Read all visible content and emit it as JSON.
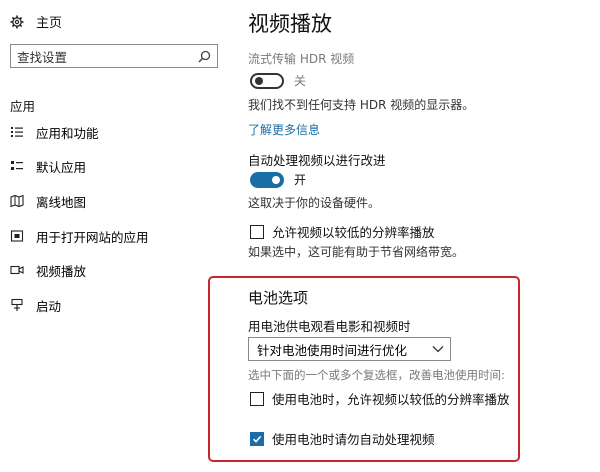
{
  "sidebar": {
    "home": {
      "label": "主页",
      "icon": "gear-icon"
    },
    "search": {
      "placeholder": "查找设置",
      "value": "查找设置",
      "icon": "search-icon"
    },
    "section_label": "应用",
    "items": [
      {
        "label": "应用和功能",
        "icon": "apps-list-icon",
        "selected": false
      },
      {
        "label": "默认应用",
        "icon": "default-apps-icon",
        "selected": false
      },
      {
        "label": "离线地图",
        "icon": "offline-maps-icon",
        "selected": false
      },
      {
        "label": "用于打开网站的应用",
        "icon": "apps-for-websites-icon",
        "selected": false
      },
      {
        "label": "视频播放",
        "icon": "video-playback-icon",
        "selected": true
      },
      {
        "label": "启动",
        "icon": "startup-icon",
        "selected": false
      }
    ]
  },
  "main": {
    "title": "视频播放",
    "hdr": {
      "heading": "流式传输 HDR 视频",
      "toggle_state": "关",
      "toggle_on": false,
      "note": "我们找不到任何支持 HDR 视频的显示器。",
      "link": "了解更多信息"
    },
    "auto_process": {
      "heading": "自动处理视频以进行改进",
      "toggle_state": "开",
      "toggle_on": true,
      "note": "这取决于你的设备硬件。"
    },
    "low_res": {
      "label": "允许视频以较低的分辨率播放",
      "checked": false,
      "note": "如果选中，这可能有助于节省网络带宽。"
    },
    "battery": {
      "heading": "电池选项",
      "subheading": "用电池供电观看电影和视频时",
      "select_value": "针对电池使用时间进行优化",
      "hint": "选中下面的一个或多个复选框，改善电池使用时间:",
      "options": [
        {
          "label": "使用电池时，允许视频以较低的分辨率播放",
          "checked": false
        },
        {
          "label": "使用电池时请勿自动处理视频",
          "checked": true
        }
      ]
    }
  },
  "colors": {
    "accent": "#1a6ea8",
    "highlight_border": "#c8272d",
    "link": "#1a6ea8"
  }
}
